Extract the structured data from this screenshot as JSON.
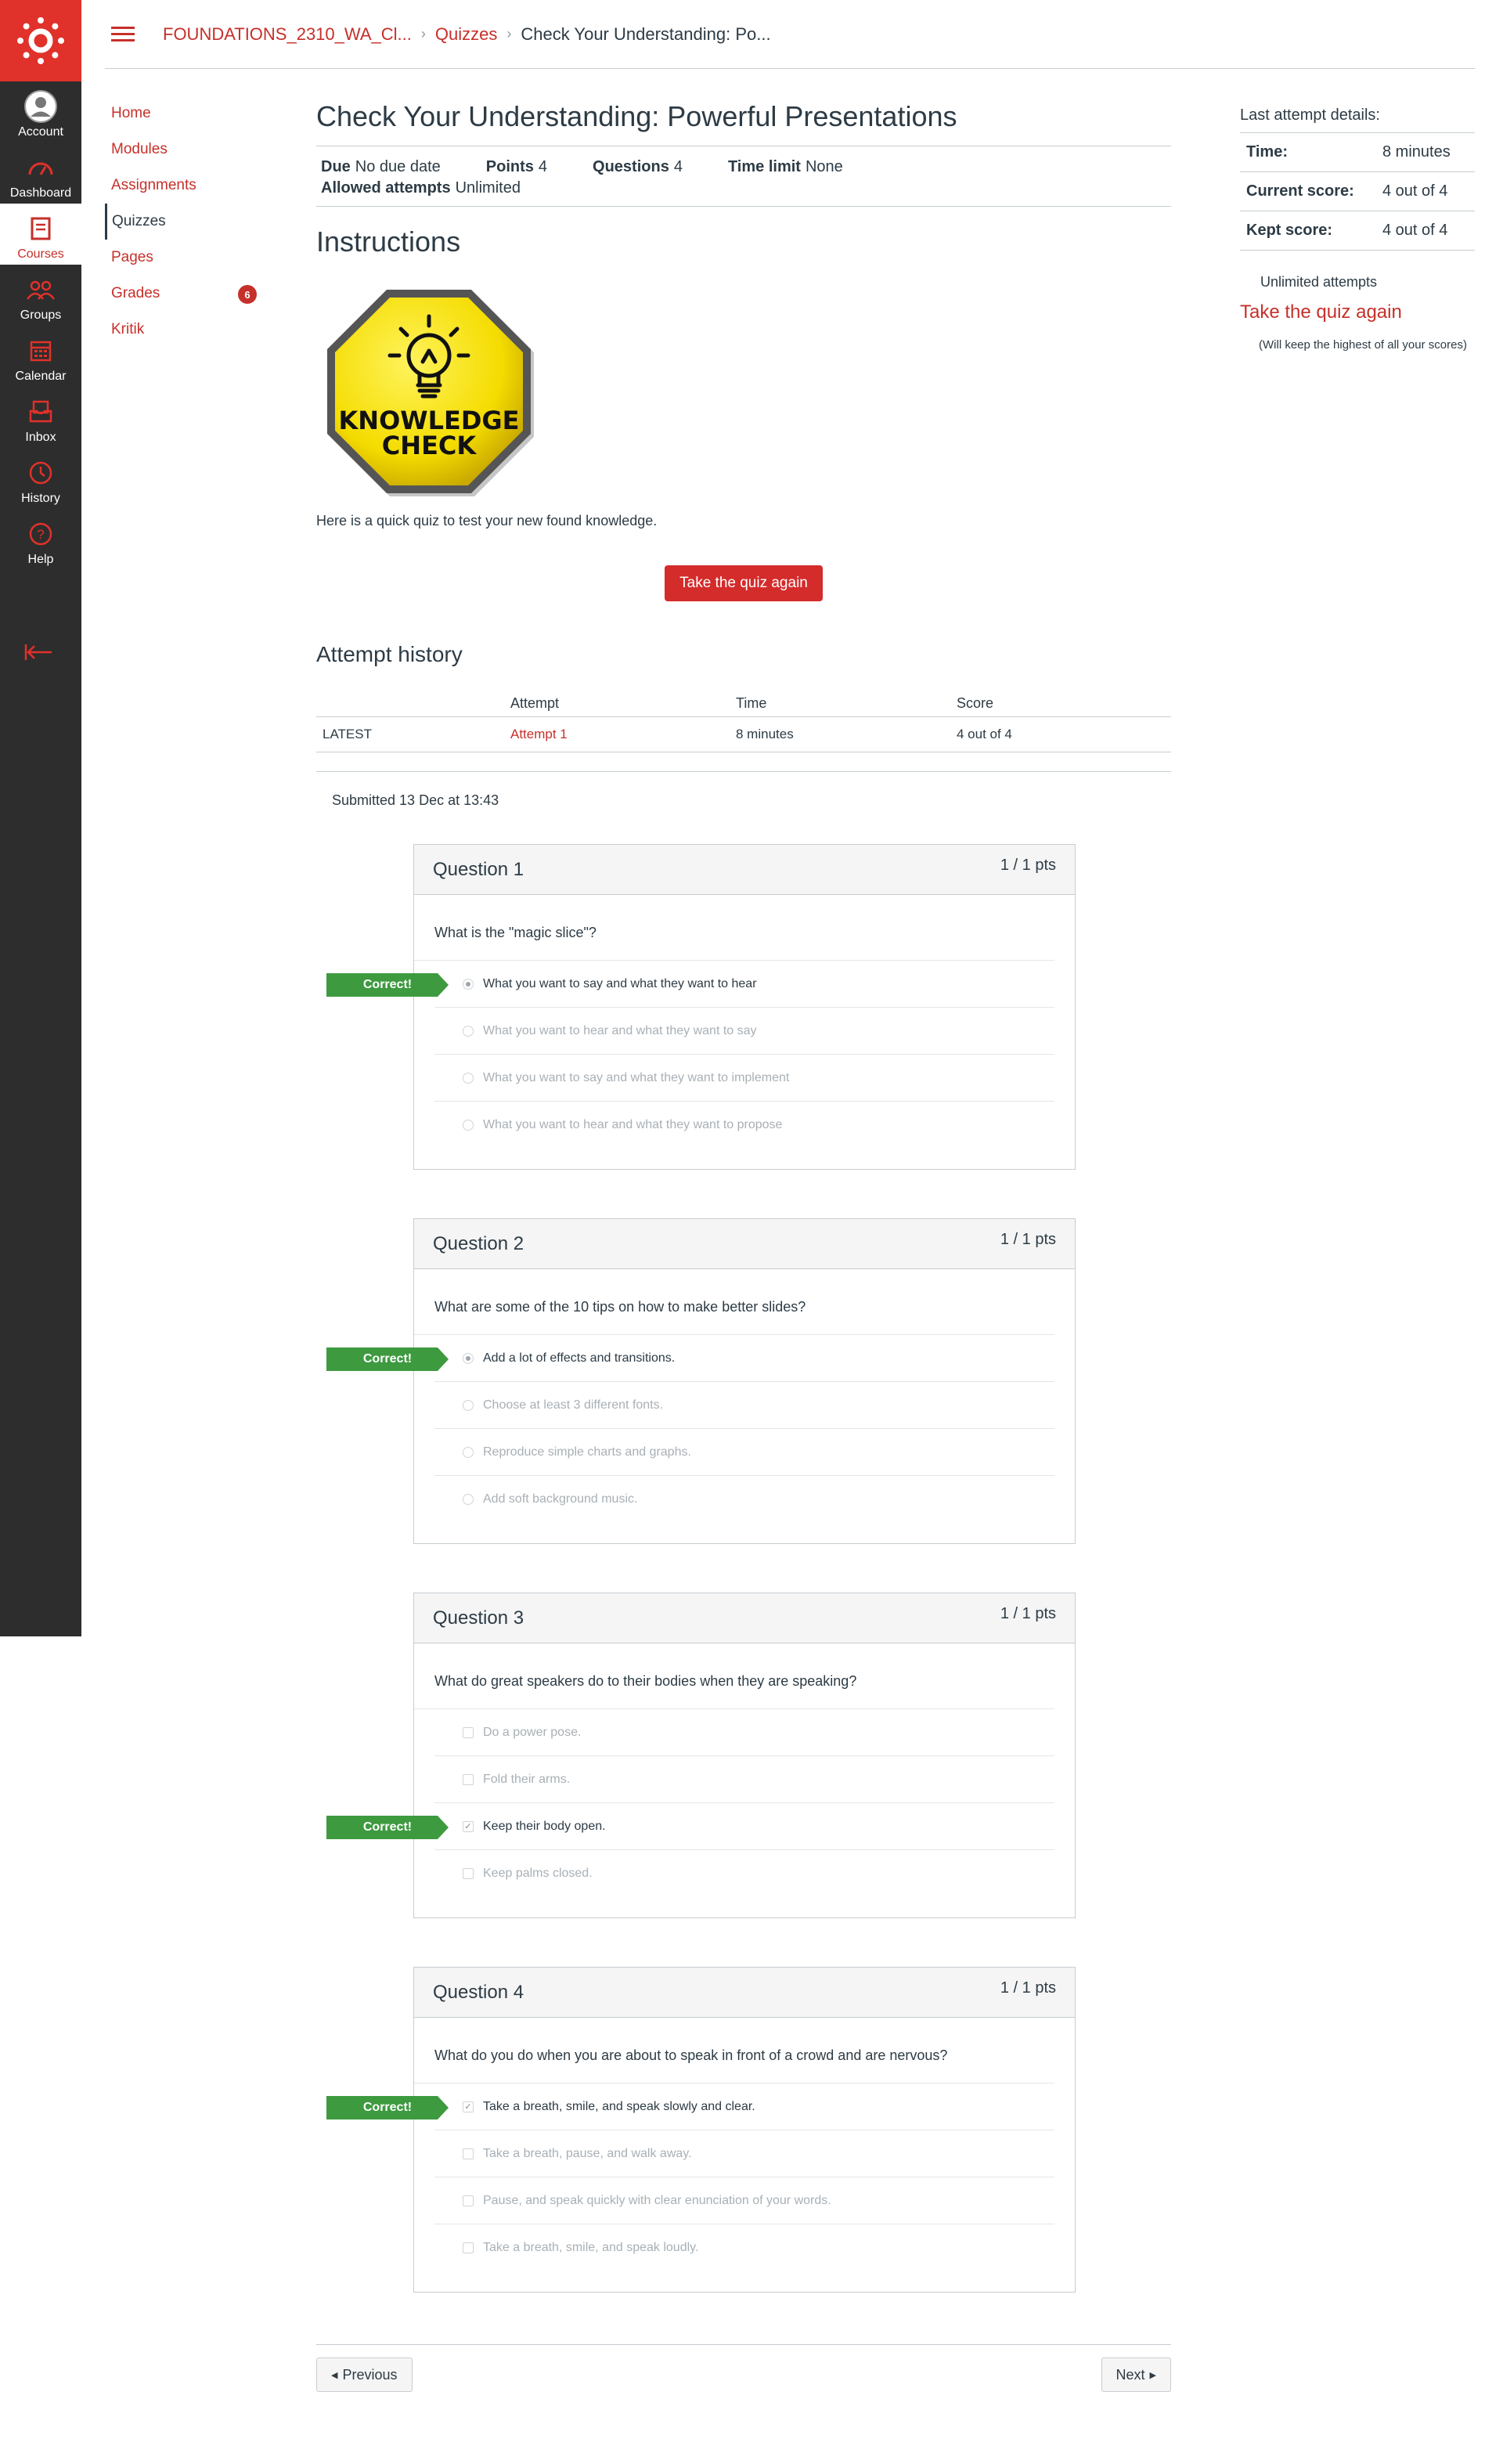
{
  "global_nav": {
    "items": [
      {
        "label": "Account",
        "icon": "account-icon"
      },
      {
        "label": "Dashboard",
        "icon": "dashboard-icon"
      },
      {
        "label": "Courses",
        "icon": "courses-icon"
      },
      {
        "label": "Groups",
        "icon": "groups-icon"
      },
      {
        "label": "Calendar",
        "icon": "calendar-icon"
      },
      {
        "label": "Inbox",
        "icon": "inbox-icon"
      },
      {
        "label": "History",
        "icon": "history-icon"
      },
      {
        "label": "Help",
        "icon": "help-icon"
      }
    ],
    "active": "Courses",
    "brand_color": "#e0312a"
  },
  "breadcrumb": {
    "course": "FOUNDATIONS_2310_WA_Cl...",
    "section": "Quizzes",
    "current": "Check Your Understanding: Po..."
  },
  "course_nav": {
    "items": [
      {
        "label": "Home"
      },
      {
        "label": "Modules"
      },
      {
        "label": "Assignments"
      },
      {
        "label": "Quizzes"
      },
      {
        "label": "Pages"
      },
      {
        "label": "Grades",
        "badge": "6"
      },
      {
        "label": "Kritik"
      }
    ],
    "active": "Quizzes"
  },
  "quiz": {
    "title": "Check Your Understanding: Powerful Presentations",
    "due_label": "Due",
    "due_value": "No due date",
    "points_label": "Points",
    "points_value": "4",
    "questions_label": "Questions",
    "questions_value": "4",
    "time_limit_label": "Time limit",
    "time_limit_value": "None",
    "allowed_label": "Allowed attempts",
    "allowed_value": "Unlimited",
    "instructions_heading": "Instructions",
    "image_text_line1": "KNOWLEDGE",
    "image_text_line2": "CHECK",
    "description": "Here is a quick quiz to test your new found knowledge.",
    "take_again_button": "Take the quiz again"
  },
  "attempt_history": {
    "heading": "Attempt history",
    "columns": [
      "",
      "Attempt",
      "Time",
      "Score"
    ],
    "rows": [
      {
        "tag": "LATEST",
        "attempt": "Attempt 1",
        "time": "8 minutes",
        "score": "4 out of 4"
      }
    ],
    "submitted": "Submitted 13 Dec at 13:43"
  },
  "questions": [
    {
      "title": "Question 1",
      "points": "1 / 1 pts",
      "text": "What is the \"magic slice\"?",
      "type": "radio",
      "correct_label": "Correct!",
      "answers": [
        {
          "text": "What you want to say and what they want to hear",
          "selected": true
        },
        {
          "text": "What you want to hear and what they want to say",
          "selected": false
        },
        {
          "text": "What you want to say and what they want to implement",
          "selected": false
        },
        {
          "text": "What you want to hear and what they want to propose",
          "selected": false
        }
      ]
    },
    {
      "title": "Question 2",
      "points": "1 / 1 pts",
      "text": "What are some of the 10 tips on how to make better slides?",
      "type": "radio",
      "correct_label": "Correct!",
      "answers": [
        {
          "text": "Add a lot of effects and transitions.",
          "selected": true
        },
        {
          "text": "Choose at least 3 different fonts.",
          "selected": false
        },
        {
          "text": "Reproduce simple charts and graphs.",
          "selected": false
        },
        {
          "text": "Add soft background music.",
          "selected": false
        }
      ]
    },
    {
      "title": "Question 3",
      "points": "1 / 1 pts",
      "text": "What do great speakers do to their bodies when they are speaking?",
      "type": "checkbox",
      "correct_label": "Correct!",
      "answers": [
        {
          "text": "Do a power pose.",
          "selected": false
        },
        {
          "text": "Fold their arms.",
          "selected": false
        },
        {
          "text": "Keep their body open.",
          "selected": true
        },
        {
          "text": "Keep palms closed.",
          "selected": false
        }
      ]
    },
    {
      "title": "Question 4",
      "points": "1 / 1 pts",
      "text": "What do you do when you are about to speak in front of a crowd and are nervous?",
      "type": "checkbox",
      "correct_label": "Correct!",
      "answers": [
        {
          "text": "Take a breath, smile, and speak slowly and clear.",
          "selected": true
        },
        {
          "text": "Take a breath, pause, and walk away.",
          "selected": false
        },
        {
          "text": "Pause, and speak quickly with clear enunciation of your words.",
          "selected": false
        },
        {
          "text": "Take a breath, smile, and speak loudly.",
          "selected": false
        }
      ]
    }
  ],
  "pager": {
    "previous": "Previous",
    "next": "Next"
  },
  "sidebar": {
    "heading": "Last attempt details:",
    "time_label": "Time:",
    "time_value": "8 minutes",
    "current_label": "Current score:",
    "current_value": "4 out of 4",
    "kept_label": "Kept score:",
    "kept_value": "4 out of 4",
    "unlimited": "Unlimited attempts",
    "take_again_link": "Take the quiz again",
    "keep_note": "(Will keep the highest of all your scores)"
  },
  "colors": {
    "accent": "#c6302a",
    "correct_green": "#3d9a3f",
    "nav_dark": "#2d2d2d"
  }
}
